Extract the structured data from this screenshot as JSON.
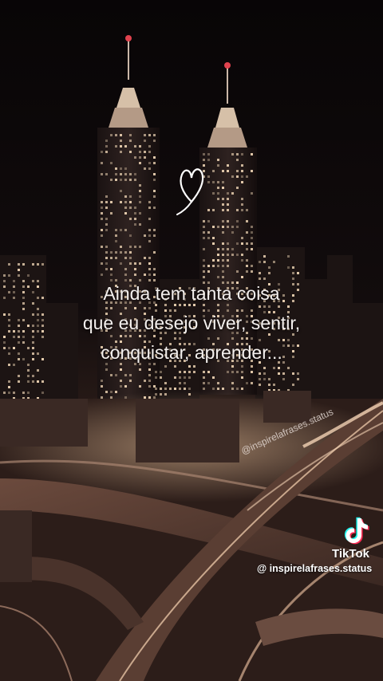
{
  "overlay": {
    "quote_lines": [
      "Ainda tem tanta coisa",
      "que eu desejo viver, sentir,",
      "conquistar, aprender..."
    ],
    "watermark": "@inspirelafrases.status"
  },
  "tiktok": {
    "brand": "TikTok",
    "handle": "@ inspirelafrases.status",
    "logo_icon": "tiktok-logo-icon"
  },
  "icons": {
    "heart": "heart-doodle-icon"
  },
  "colors": {
    "sky": "#0b0708",
    "lights": "#f3d9b8",
    "beacon": "#e0424e",
    "text": "#f4f0ee"
  }
}
